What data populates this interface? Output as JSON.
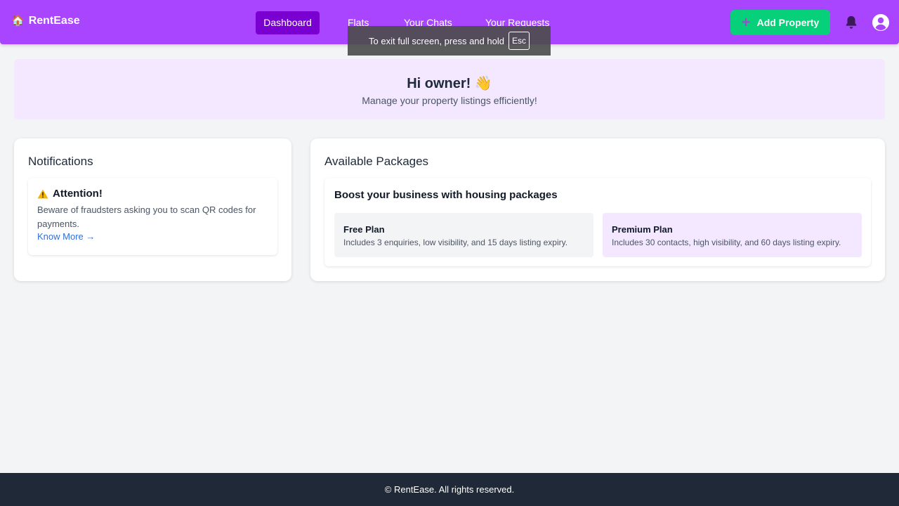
{
  "brand": {
    "name": "RentEase"
  },
  "nav": {
    "items": [
      {
        "label": "Dashboard"
      },
      {
        "label": "Flats"
      },
      {
        "label": "Your Chats"
      },
      {
        "label": "Your Requests"
      }
    ],
    "add_property_label": "Add Property"
  },
  "fullscreen_notice": {
    "text": "To exit full screen, press and hold",
    "key": "Esc"
  },
  "hero": {
    "title": "Hi owner! 👋",
    "subtitle": "Manage your property listings efficiently!"
  },
  "notifications": {
    "title": "Notifications",
    "alert_title": "Attention!",
    "alert_text": "Beware of fraudsters asking you to scan QR codes for payments.",
    "link_text": "Know More →"
  },
  "packages": {
    "title": "Available Packages",
    "subtitle": "Boost your business with housing packages",
    "plans": [
      {
        "name": "Free Plan",
        "description": "Includes 3 enquiries, low visibility, and 15 days listing expiry."
      },
      {
        "name": "Premium Plan",
        "description": "Includes 30 contacts, high visibility, and 60 days listing expiry."
      }
    ]
  },
  "footer": {
    "text": "© RentEase. All rights reserved."
  },
  "colors": {
    "navbar": "#a944ff",
    "nav_active": "#7a00d1",
    "add_button": "#06d07a",
    "hero_bg": "#f3e8ff",
    "footer_bg": "#1f2937",
    "link": "#2f6fd6"
  },
  "icons": [
    "house-icon",
    "plus-icon",
    "bell-icon",
    "user-icon",
    "warning-icon"
  ]
}
